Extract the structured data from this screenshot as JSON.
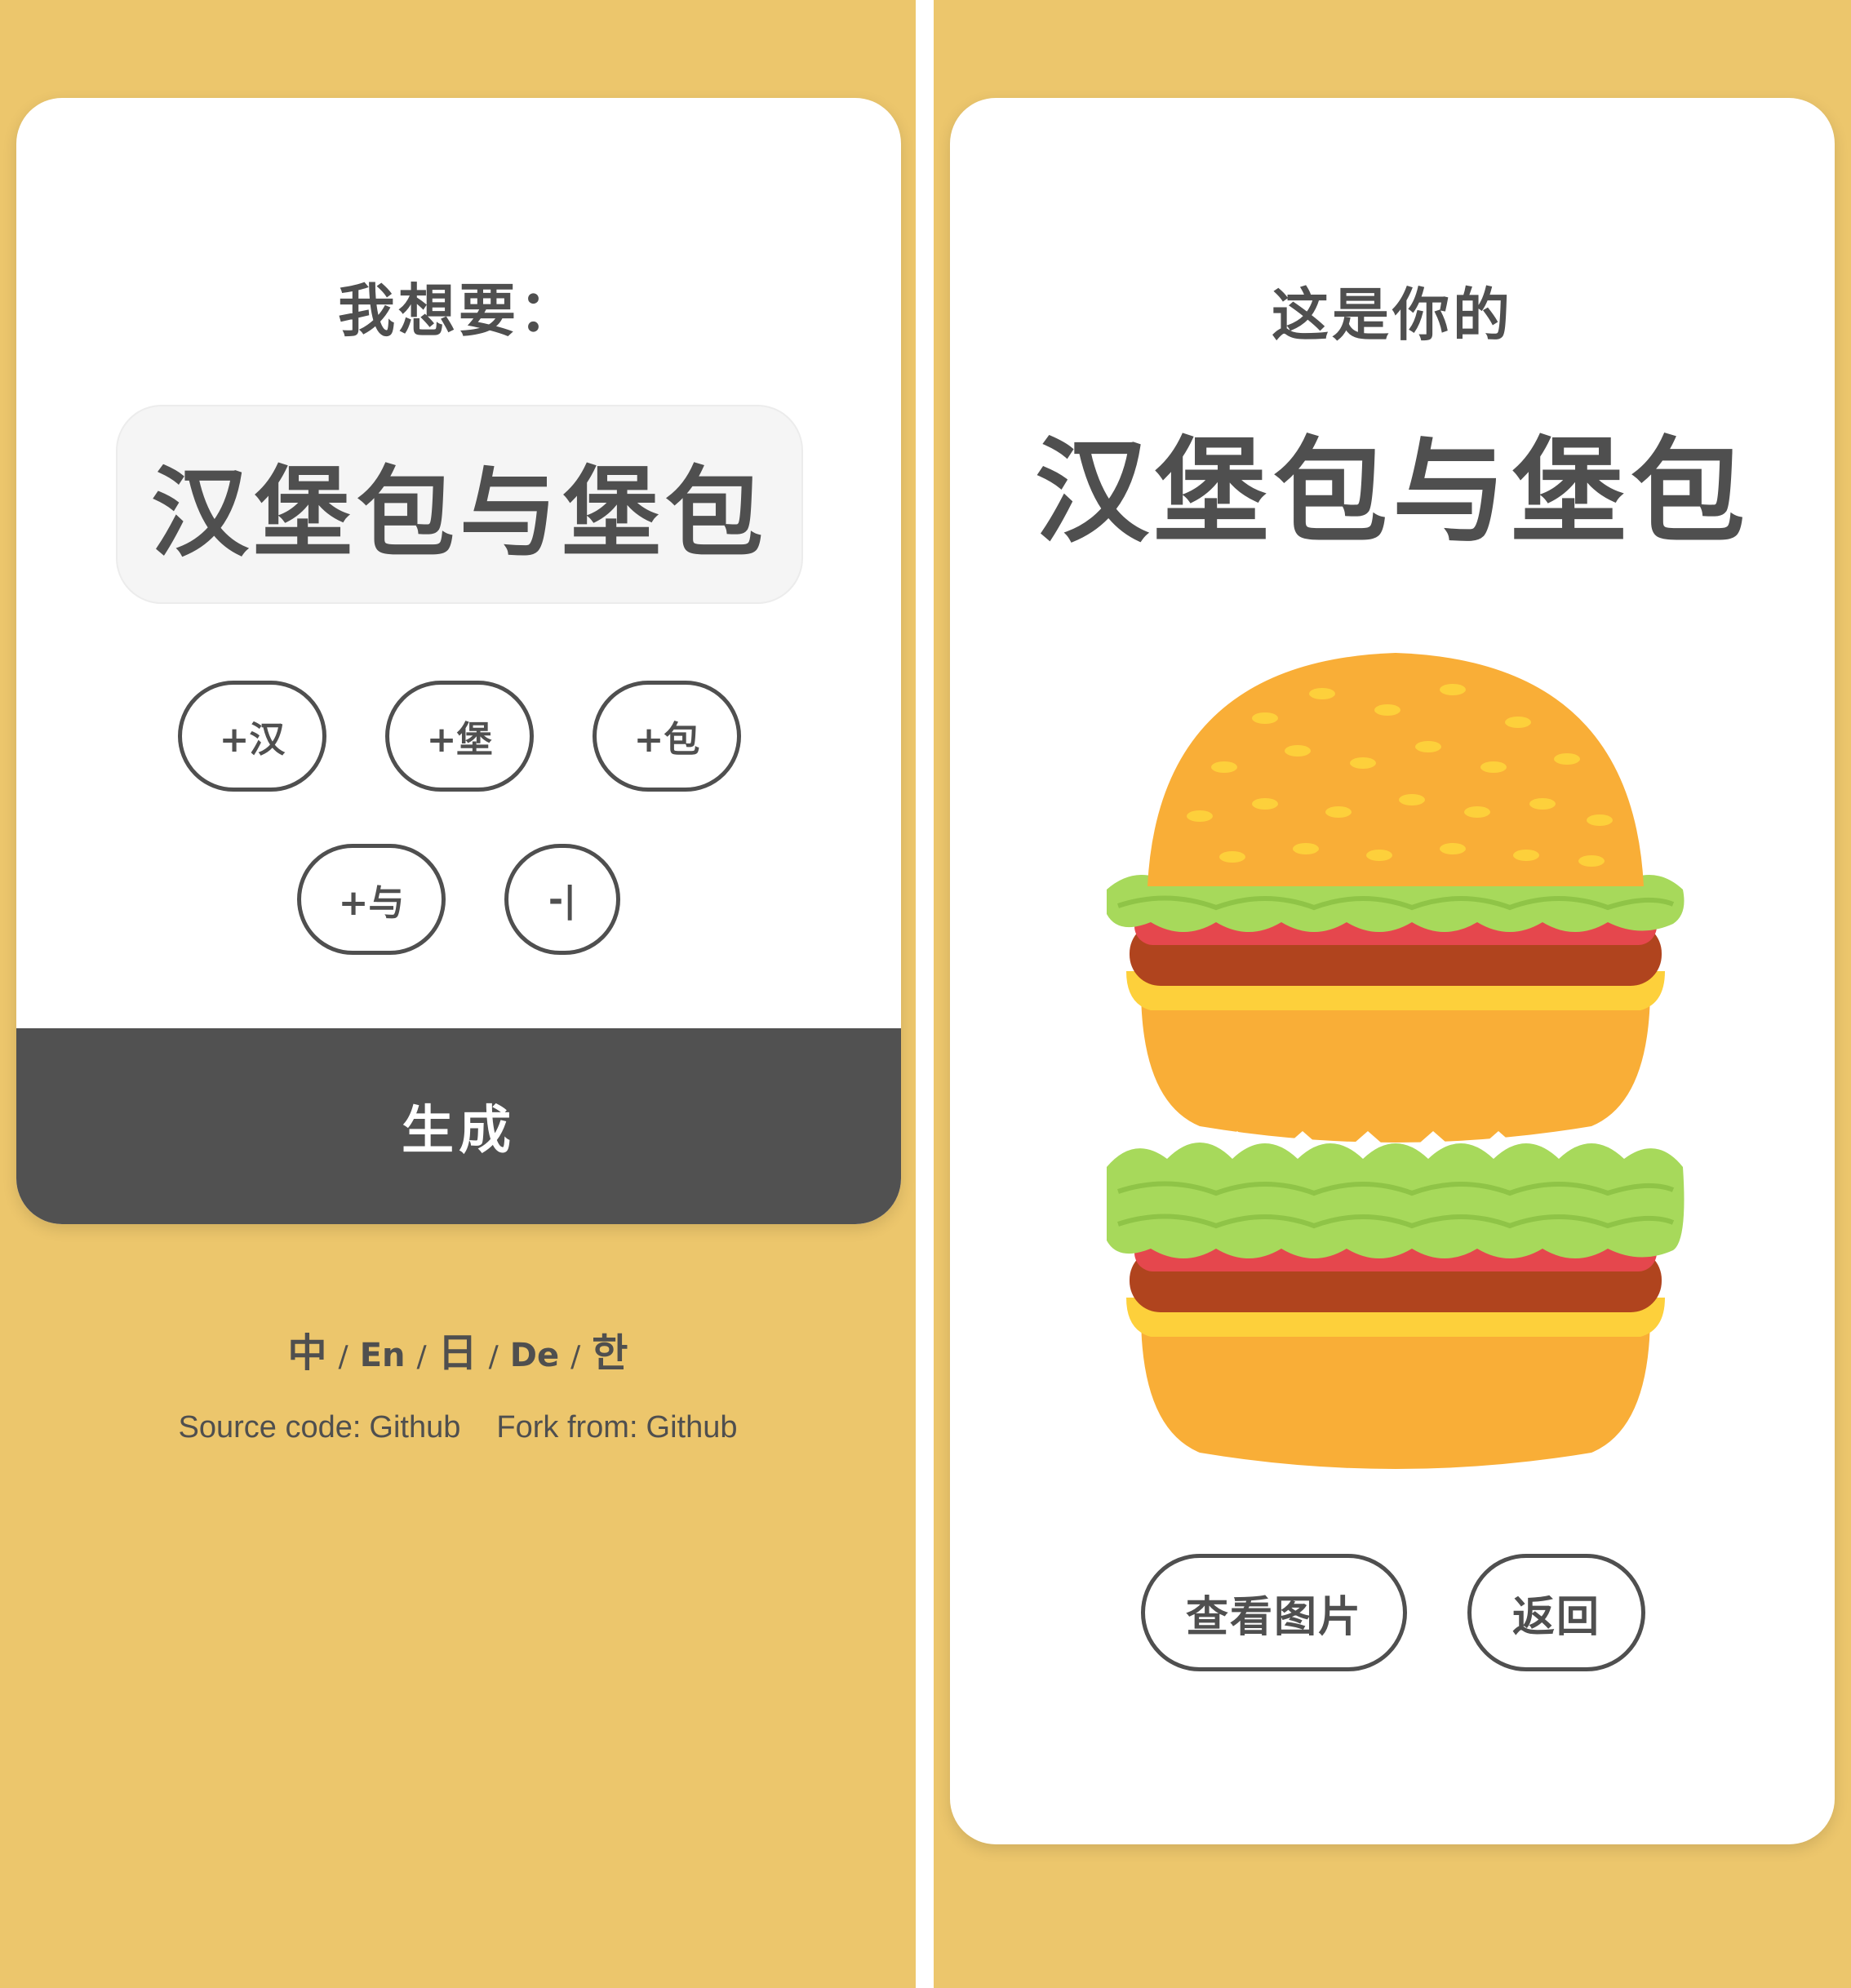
{
  "left": {
    "prompt_label": "我想要：",
    "current_word": "汉堡包与堡包",
    "buttons": [
      {
        "label": "+汉"
      },
      {
        "label": "+堡"
      },
      {
        "label": "+包"
      },
      {
        "label": "+与"
      },
      {
        "label": "-|"
      }
    ],
    "generate_label": "生成",
    "languages": [
      {
        "label": "中"
      },
      {
        "label": "En"
      },
      {
        "label": "日"
      },
      {
        "label": "De"
      },
      {
        "label": "한"
      }
    ],
    "separator": "/",
    "footer": {
      "source_label": "Source code:",
      "source_link": "Github",
      "fork_label": "Fork from:",
      "fork_link": "Github"
    }
  },
  "right": {
    "result_label": "这是你的",
    "result_title": "汉堡包与堡包",
    "view_image_label": "查看图片",
    "back_label": "返回"
  },
  "colors": {
    "background": "#ecc66c",
    "card": "#ffffff",
    "text": "#4f4f4f",
    "generate_bar": "#515151",
    "bun": "#f9ae37",
    "lettuce": "#a7d95b",
    "tomato": "#e5474d",
    "patty": "#b0441e",
    "cheese": "#fdd03b"
  }
}
